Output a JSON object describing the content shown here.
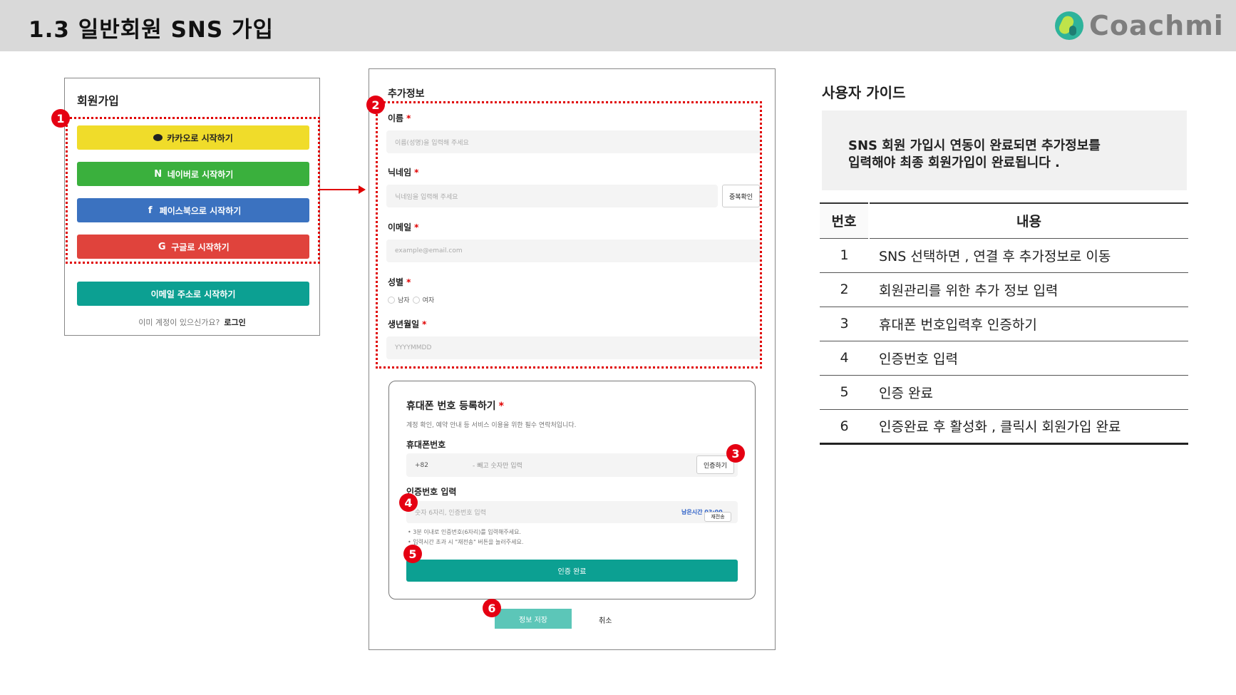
{
  "header": {
    "title": "1.3  일반회원  SNS  가입",
    "logo_text": "Coachmi"
  },
  "signup": {
    "title": "회원가입",
    "kakao_label": "카카오로 시작하기",
    "naver_label": "네이버로 시작하기",
    "naver_icon": "N",
    "facebook_label": "페이스북으로 시작하기",
    "facebook_icon": "f",
    "google_label": "구글로 시작하기",
    "google_icon": "G",
    "email_label": "이메일 주소로 시작하기",
    "account_prompt": "이미 계정이 있으신가요?",
    "login_link": "로그인"
  },
  "markers": [
    "1",
    "2",
    "3",
    "4",
    "5",
    "6"
  ],
  "form": {
    "section_title": "추가정보",
    "required_mark": "*",
    "name_label": "이름",
    "name_placeholder": "이름(성명)을 입력해 주세요",
    "nickname_label": "닉네임",
    "nickname_placeholder": "닉네임을 입력해 주세요",
    "duplicate_check": "중복확인",
    "email_label": "이메일",
    "email_placeholder": "example@email.com",
    "gender_label": "성별",
    "gender_male": "남자",
    "gender_female": "여자",
    "birth_label": "생년월일",
    "birth_placeholder": "YYYYMMDD"
  },
  "phone": {
    "title": "휴대폰 번호 등록하기",
    "description": "계정 확인, 예약 안내 등 서비스 이용을 위한 필수 연락처입니다.",
    "phone_label": "휴대폰번호",
    "country_code": "+82",
    "phone_placeholder": "- 빼고 숫자만 입력",
    "verify_button": "인증하기",
    "code_label": "인증번호 입력",
    "code_placeholder": "숫자 6자리, 인증번호 입력",
    "time_left": "남은시간 03:00",
    "resend_button": "재전송",
    "note_1": "• 3분 이내로 인증번호(6자리)를 입력해주세요.",
    "note_2": "• 입력시간 초과 시 \"재전송\" 버튼을 눌러주세요.",
    "complete_button": "인증 완료"
  },
  "actions": {
    "save_button": "정보 저장",
    "cancel_button": "취소"
  },
  "guide": {
    "title": "사용자 가이드",
    "box_line_1": "SNS  회원 가입시 연동이 완료되면 추가정보를",
    "box_line_2": "입력해야 최종 회원가입이 완료됩니다 .",
    "col_num": "번호",
    "col_content": "내용",
    "rows": [
      {
        "num": "1",
        "text": "SNS  선택하면 ,  연결 후 추가정보로 이동"
      },
      {
        "num": "2",
        "text": "회원관리를 위한 추가 정보 입력"
      },
      {
        "num": "3",
        "text": "휴대폰 번호입력후 인증하기"
      },
      {
        "num": "4",
        "text": "인증번호 입력"
      },
      {
        "num": "5",
        "text": "인증 완료"
      },
      {
        "num": "6",
        "text": "인증완료 후 활성화 ,  클릭시 회원가입 완료"
      }
    ]
  },
  "colors": {
    "kakao": "#f0dc2a",
    "naver": "#3ab03d",
    "facebook": "#3b72c0",
    "google": "#e0433c",
    "teal": "#0ca092",
    "marker": "#e50012"
  }
}
